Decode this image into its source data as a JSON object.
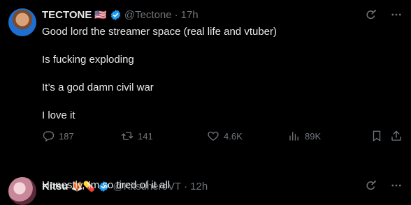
{
  "tweets": [
    {
      "author": {
        "name": "TECTONE",
        "flag": "🇺🇸",
        "handle": "@Tectone",
        "time": "17h"
      },
      "lines": [
        "Good lord the streamer space (real life and vtuber)",
        "Is fucking exploding",
        "It’s a god damn civil war",
        "I love it"
      ],
      "stats": {
        "replies": "187",
        "reposts": "141",
        "likes": "4.6K",
        "views": "89K"
      }
    },
    {
      "author": {
        "name": "Kitsu",
        "emojis": "🦊💊",
        "handle": "@KitsuneroVT",
        "time": "12h"
      },
      "lines": [
        "Honestly, Im so tired of it all"
      ]
    }
  ],
  "ui": {
    "separator": "·",
    "colors": {
      "background": "#000000",
      "text": "#e7e9ea",
      "muted": "#71767b",
      "verified": "#1d9bf0"
    },
    "icons": [
      "grok-icon",
      "more-icon",
      "reply-icon",
      "repost-icon",
      "like-icon",
      "views-icon",
      "bookmark-icon",
      "share-icon",
      "verified-icon"
    ]
  }
}
